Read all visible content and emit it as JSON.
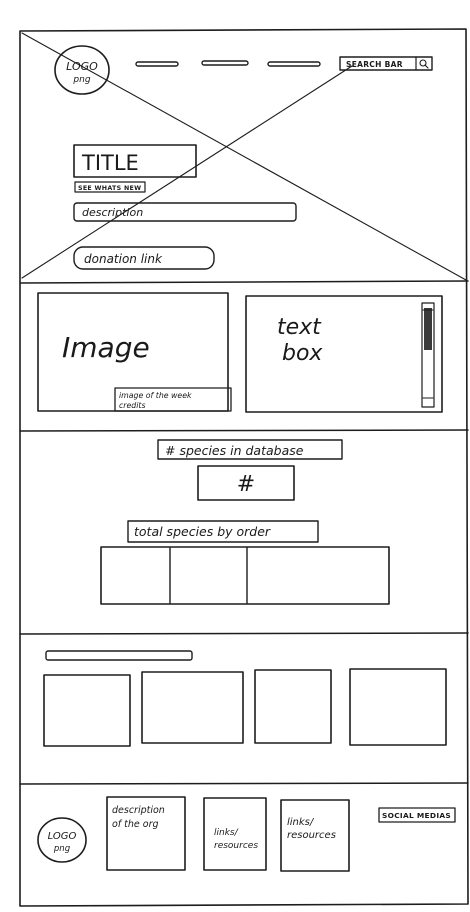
{
  "header": {
    "logo": {
      "line1": "LOGO",
      "line2": "png"
    },
    "search_bar": {
      "label": "SEARCH BAR",
      "icon": "search-icon"
    },
    "title": "TITLE",
    "see_whats_new": "SEE WHATS NEW",
    "description": "description",
    "donation_link": "donation link"
  },
  "feature": {
    "image_label": "Image",
    "image_caption": [
      "image of the week",
      "credits"
    ],
    "text_box": [
      "text",
      "box"
    ]
  },
  "stats": {
    "species_label": "# species in database",
    "species_count": "#",
    "order_label": "total species by order"
  },
  "footer": {
    "logo": {
      "line1": "LOGO",
      "line2": "png"
    },
    "description": [
      "description",
      "of the org"
    ],
    "links_a": [
      "links/",
      "resources"
    ],
    "links_b": [
      "links/",
      "resources"
    ],
    "social_medias": "SOCIAL MEDIAS"
  }
}
